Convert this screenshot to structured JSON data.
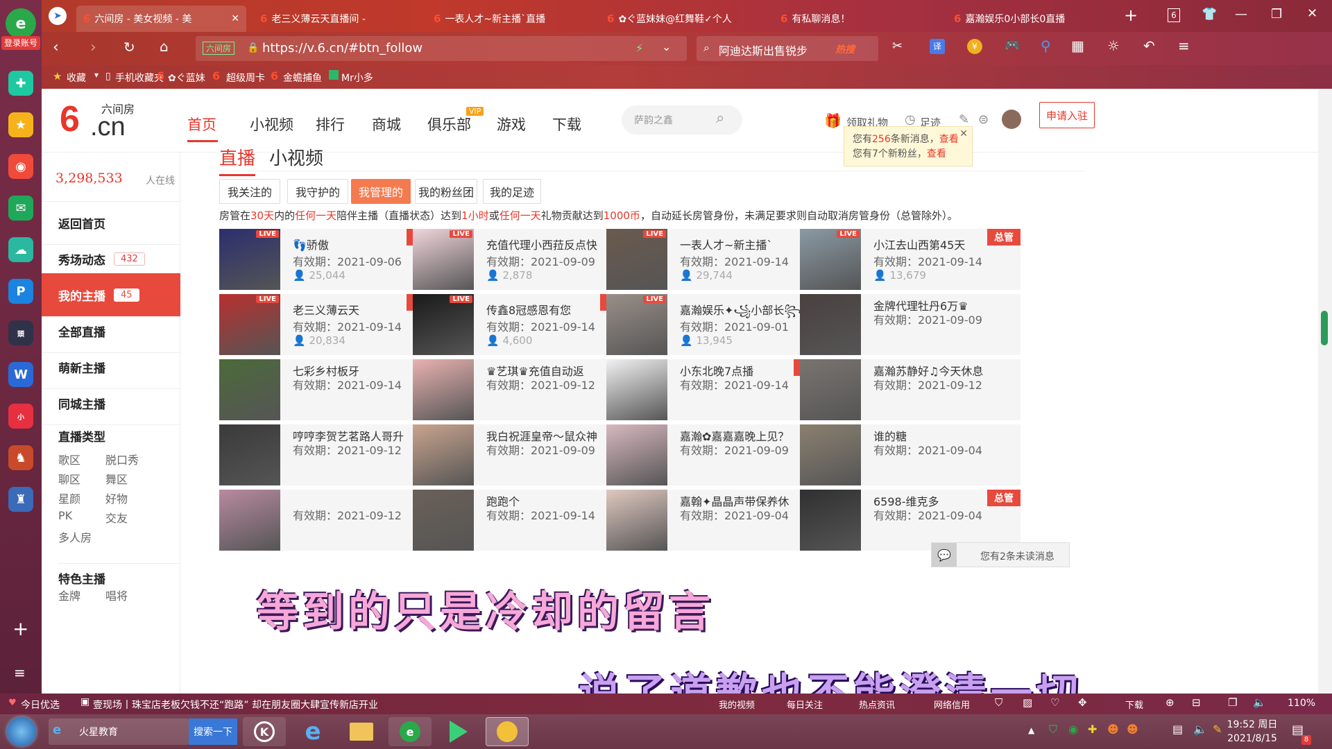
{
  "dock": {
    "login_label": "登录账号"
  },
  "tabs": [
    {
      "title": "六间房 - 美女视频 - 美"
    },
    {
      "title": "老三义薄云天直播间 -"
    },
    {
      "title": "一表人才~新主播`直播"
    },
    {
      "title": "✿ぐ蓝妹妹@红舞鞋✓个人"
    },
    {
      "title": "有私聊消息！"
    },
    {
      "title": "嘉瀚娱乐0小部长0直播"
    }
  ],
  "tabcount": "6",
  "address": {
    "site_label": "六间房",
    "url": "https://v.6.cn/#btn_follow"
  },
  "search": {
    "text": "阿迪达斯出售锐步",
    "hot": "热搜"
  },
  "bookmarks": [
    "收藏",
    "手机收藏夹",
    "✿ぐ蓝妹",
    "超级周卡",
    "金蟾捕鱼",
    "Mr小多"
  ],
  "site": {
    "logo_top": "六间房",
    "logo_main": ".cn",
    "nav": [
      "首页",
      "小视频",
      "排行",
      "商城",
      "俱乐部",
      "游戏",
      "下载"
    ],
    "vip": "VIP",
    "search_placeholder": "萨韵之鑫",
    "gift": "领取礼物",
    "history": "足迹",
    "apply": "申请入驻"
  },
  "notice": {
    "line1_a": "您有",
    "line1_num": "256",
    "line1_b": "条新消息，",
    "line1_link": "查看",
    "line2_a": "您有7个新粉丝，",
    "line2_link": "查看"
  },
  "sidebar": {
    "online_count": "3,298,533",
    "online_label": "人在线",
    "items": [
      {
        "label": "返回首页",
        "badge": ""
      },
      {
        "label": "秀场动态",
        "badge": "432"
      },
      {
        "label": "我的主播",
        "badge": "45"
      },
      {
        "label": "全部直播",
        "badge": ""
      },
      {
        "label": "萌新主播",
        "badge": ""
      },
      {
        "label": "同城主播",
        "badge": ""
      }
    ],
    "type_title": "直播类型",
    "types": [
      "歌区",
      "脱口秀",
      "聊区",
      "舞区",
      "星颜",
      "好物",
      "PK",
      "交友",
      "多人房"
    ],
    "special_title": "特色主播",
    "special_items": [
      "金牌",
      "唱将"
    ]
  },
  "main": {
    "tab_live": "直播",
    "tab_video": "小视频",
    "filters": [
      "我关注的",
      "我守护的",
      "我管理的",
      "我的粉丝团",
      "我的足迹"
    ],
    "rule": [
      {
        "t": "房管在",
        "h": false
      },
      {
        "t": "30天",
        "h": true
      },
      {
        "t": "内的",
        "h": false
      },
      {
        "t": "任何一天",
        "h": true
      },
      {
        "t": "陪伴主播（直播状态）达到",
        "h": false
      },
      {
        "t": "1小时",
        "h": true
      },
      {
        "t": "或",
        "h": false
      },
      {
        "t": "任何一天",
        "h": true
      },
      {
        "t": "礼物贡献达到",
        "h": false
      },
      {
        "t": "1000币",
        "h": true
      },
      {
        "t": "，自动延长房管身份，未满足要求则自动取消房管身份（总管除外）。",
        "h": false
      }
    ],
    "admin_tag": "总管",
    "live_tag": "LIVE",
    "cards": [
      {
        "name": "👣骄傲",
        "expire": "有效期：2021-09-06",
        "views": "25,044",
        "admin": true,
        "live": true,
        "color": "#2b2f6e"
      },
      {
        "name": "充值代理小西菈反点快",
        "expire": "有效期：2021-09-09",
        "views": "2,878",
        "admin": false,
        "live": true,
        "color": "#f1d5dc"
      },
      {
        "name": "一表人才~新主播`",
        "expire": "有效期：2021-09-14",
        "views": "29,744",
        "admin": false,
        "live": true,
        "color": "#6a5a4e"
      },
      {
        "name": "小江去山西第45天",
        "expire": "有效期：2021-09-14",
        "views": "13,679",
        "admin": true,
        "live": true,
        "color": "#8a9aa5"
      },
      {
        "name": "老三义薄云天",
        "expire": "有效期：2021-09-14",
        "views": "20,834",
        "admin": true,
        "live": true,
        "color": "#b8302e"
      },
      {
        "name": "传鑫8冠感恩有您",
        "expire": "有效期：2021-09-14",
        "views": "4,600",
        "admin": true,
        "live": true,
        "color": "#1a1a1a"
      },
      {
        "name": "嘉瀚娱乐✦꧁小部长꧂",
        "expire": "有效期：2021-09-01",
        "views": "13,945",
        "admin": false,
        "live": true,
        "color": "#9a8f88"
      },
      {
        "name": "金牌代理牡丹6万♛",
        "expire": "有效期：2021-09-09",
        "views": "",
        "admin": false,
        "live": false,
        "color": "#4a4040"
      },
      {
        "name": "七彩乡村板牙",
        "expire": "有效期：2021-09-14",
        "views": "",
        "admin": false,
        "live": false,
        "color": "#4c6a3a"
      },
      {
        "name": "♛艺琪♛充值自动返",
        "expire": "有效期：2021-09-12",
        "views": "",
        "admin": false,
        "live": false,
        "color": "#e8b2b0"
      },
      {
        "name": "小东北晚7点播",
        "expire": "有效期：2021-09-14",
        "views": "",
        "admin": true,
        "live": false,
        "color": "#f2f2f2"
      },
      {
        "name": "嘉瀚苏静好♫今天休息",
        "expire": "有效期：2021-09-12",
        "views": "",
        "admin": false,
        "live": false,
        "color": "#7a7470"
      },
      {
        "name": "哼哼李贺艺茗路人哥升",
        "expire": "有效期：2021-09-12",
        "views": "",
        "admin": false,
        "live": false,
        "color": "#3a3a3a"
      },
      {
        "name": "我白祝涯皇帝～鼠众神",
        "expire": "有效期：2021-09-09",
        "views": "",
        "admin": false,
        "live": false,
        "color": "#c9a48e"
      },
      {
        "name": "嘉瀚✿嘉嘉嘉晚上见？",
        "expire": "有效期：2021-09-09",
        "views": "",
        "admin": false,
        "live": false,
        "color": "#d8b8c0"
      },
      {
        "name": "谁的糖",
        "expire": "有效期：2021-09-04",
        "views": "",
        "admin": false,
        "live": false,
        "color": "#8a8070"
      },
      {
        "name": "",
        "expire": "有效期：2021-09-12",
        "views": "",
        "admin": false,
        "live": false,
        "color": "#b88aa0"
      },
      {
        "name": "跑跑个",
        "expire": "有效期：2021-09-14",
        "views": "",
        "admin": false,
        "live": false,
        "color": "#6a6058"
      },
      {
        "name": "嘉翰✦晶晶声带保养休",
        "expire": "有效期：2021-09-04",
        "views": "",
        "admin": false,
        "live": false,
        "color": "#e0c8c0"
      },
      {
        "name": "6598-维克多",
        "expire": "有效期：2021-09-04",
        "views": "",
        "admin": true,
        "live": false,
        "color": "#303030"
      }
    ]
  },
  "subtitle": {
    "line1": "等到的只是冷却的留言",
    "line2": "说了道歉也不能澄清一切"
  },
  "chat_popup": "您有2条未读消息",
  "news_bar": {
    "left": "今日优选",
    "headline": "壹现场丨珠宝店老板欠钱不还“跑路” 却在朋友圈大肆宣传新店开业",
    "items": [
      "我的视频",
      "每日关注",
      "热点资讯",
      "网络信用",
      "下载"
    ],
    "zoom": "110%"
  },
  "taskbar": {
    "app_label": "火星教育",
    "search_btn": "搜索一下",
    "time": "19:52 周日",
    "date": "2021/8/15",
    "notif": "8"
  },
  "colors": {
    "accent": "#e8493d",
    "chrome": "#b23a2b"
  }
}
